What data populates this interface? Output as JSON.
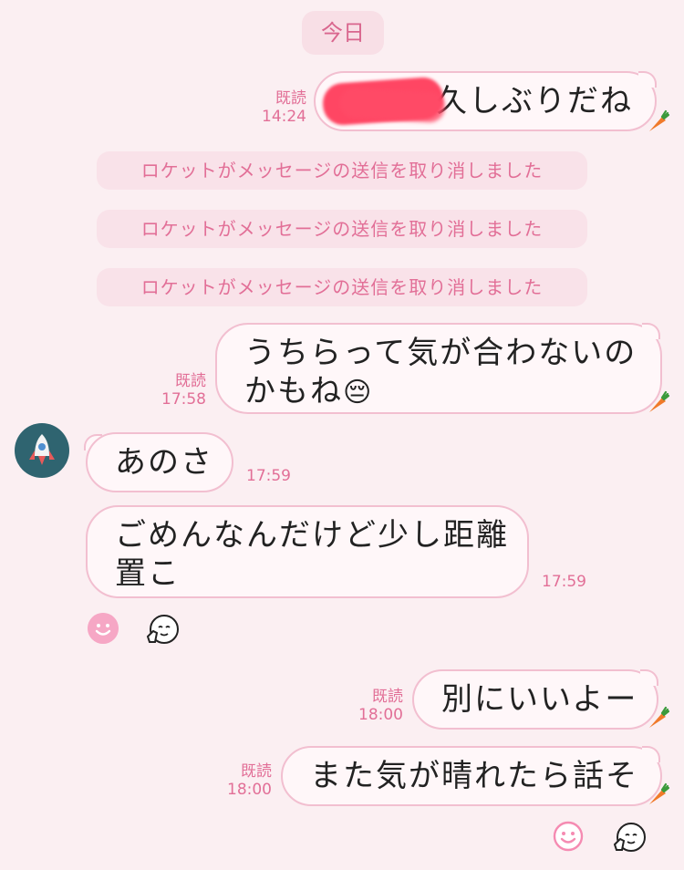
{
  "date_label": "今日",
  "messages": {
    "m1": {
      "read": "既読",
      "time": "14:24",
      "text": "久しぶりだね"
    },
    "sys": [
      "ロケットがメッセージの送信を取り消しました",
      "ロケットがメッセージの送信を取り消しました",
      "ロケットがメッセージの送信を取り消しました"
    ],
    "m2": {
      "read": "既読",
      "time": "17:58",
      "line1": "うちらって気が合わないの",
      "line2": "かもね",
      "emoji": "😔"
    },
    "m3": {
      "text": "あのさ",
      "time": "17:59"
    },
    "m4": {
      "line1": "ごめんなんだけど少し距離",
      "line2": "置こ",
      "time": "17:59"
    },
    "m5": {
      "read": "既読",
      "time": "18:00",
      "text": "別にいいよー"
    },
    "m6": {
      "read": "既読",
      "time": "18:00",
      "text": "また気が晴れたら話そ"
    }
  },
  "icons": {
    "carrot": "carrot-icon",
    "smiley": "smiley-icon",
    "reaction_sticker": "thumbs-up-face-icon",
    "avatar": "rocket-avatar-icon"
  },
  "colors": {
    "background": "#fbeff2",
    "accent_pink": "#e26f97",
    "bubble_border": "#f2bfd0",
    "avatar_bg": "#2f6470"
  }
}
